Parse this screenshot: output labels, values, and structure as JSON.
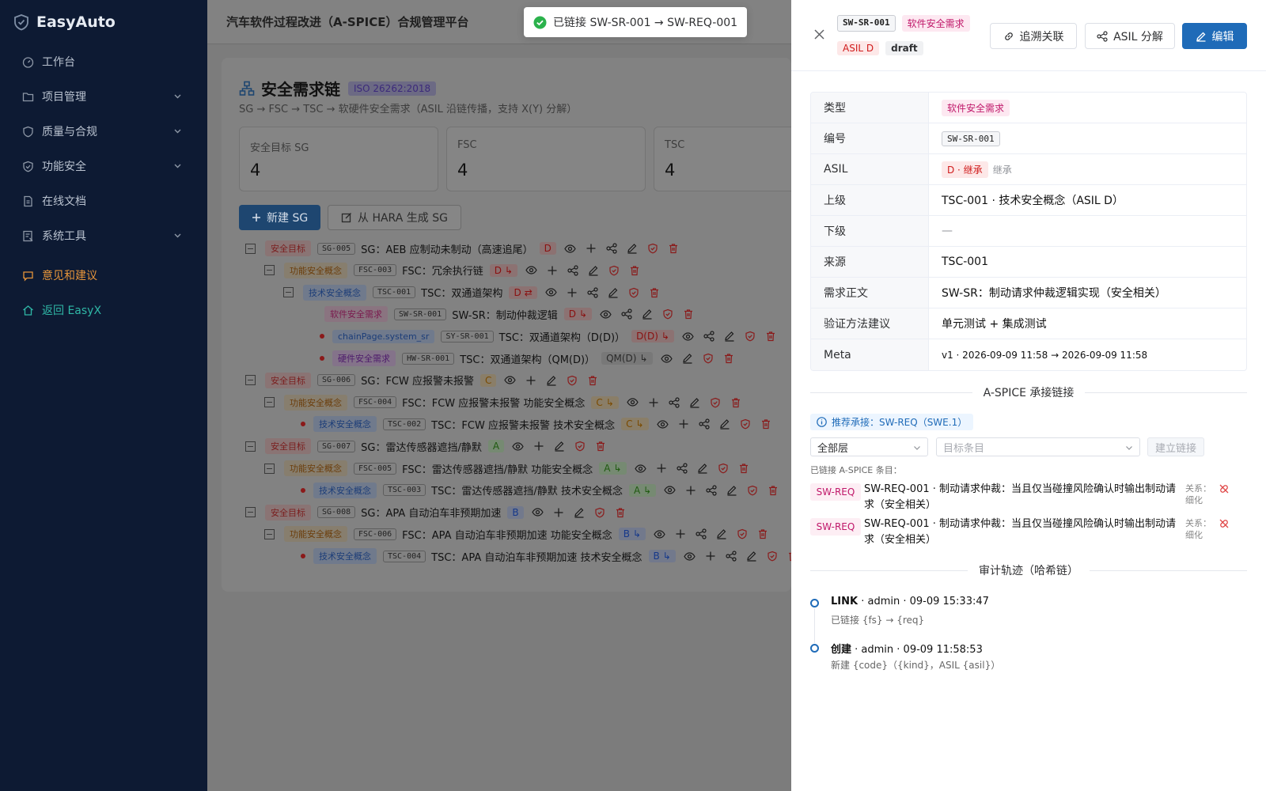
{
  "brand": "EasyAuto",
  "nav": [
    {
      "label": "工作台",
      "icon": "dashboard-icon",
      "chevron": false,
      "color": ""
    },
    {
      "label": "项目管理",
      "icon": "folder-icon",
      "chevron": true,
      "color": ""
    },
    {
      "label": "质量与合规",
      "icon": "shield-icon",
      "chevron": true,
      "color": ""
    },
    {
      "label": "功能安全",
      "icon": "shield-check-icon",
      "chevron": true,
      "color": ""
    },
    {
      "label": "在线文档",
      "icon": "document-icon",
      "chevron": false,
      "color": ""
    },
    {
      "label": "系统工具",
      "icon": "tool-icon",
      "chevron": true,
      "color": ""
    }
  ],
  "nav_extra": [
    {
      "label": "意见和建议",
      "icon": "chat-icon",
      "color": "orange"
    },
    {
      "label": "返回 EasyX",
      "icon": "home-icon",
      "color": "teal"
    }
  ],
  "page_title": "汽车软件过程改进（A-SPICE）合规管理平台",
  "chain": {
    "title": "安全需求链",
    "standard": "ISO 26262:2018",
    "subtitle": "SG → FSC → TSC → 软硬件安全需求（ASIL 沿链传播，支持 X(Y) 分解）",
    "stats": [
      {
        "label": "安全目标 SG",
        "value": "4"
      },
      {
        "label": "FSC",
        "value": "4"
      },
      {
        "label": "TSC",
        "value": "4"
      }
    ],
    "new_sg": "新建 SG",
    "from_hara": "从 HARA 生成 SG"
  },
  "tree": [
    {
      "level": 0,
      "node": "toggle",
      "kind": "安全目标",
      "kclass": "k-sg",
      "code": "SG-005",
      "title": "SG：AEB 应制动未制动（高速追尾）",
      "asil": "D",
      "aclass": "a-red",
      "asil_icon": "",
      "ops": [
        "eye",
        "plus",
        "share",
        "edit",
        "shield",
        "trash"
      ]
    },
    {
      "level": 1,
      "node": "toggle",
      "kind": "功能安全概念",
      "kclass": "k-fsc",
      "code": "FSC-003",
      "title": "FSC：冗余执行链",
      "asil": "D",
      "aclass": "a-red",
      "asil_icon": "inherit",
      "ops": [
        "eye",
        "plus",
        "share",
        "edit",
        "shield",
        "trash"
      ]
    },
    {
      "level": 2,
      "node": "toggle",
      "kind": "技术安全概念",
      "kclass": "k-tsc",
      "code": "TSC-001",
      "title": "TSC：双通道架构",
      "asil": "D",
      "aclass": "a-red",
      "asil_icon": "split",
      "ops": [
        "eye",
        "plus",
        "share",
        "edit",
        "shield",
        "trash"
      ]
    },
    {
      "level": 3,
      "node": "none",
      "kind": "软件安全需求",
      "kclass": "k-sw",
      "code": "SW-SR-001",
      "title": "SW-SR：制动仲裁逻辑",
      "asil": "D",
      "aclass": "a-red",
      "asil_icon": "inherit",
      "ops": [
        "eye",
        "share",
        "edit",
        "shield",
        "trash"
      ]
    },
    {
      "level": 3,
      "node": "dot",
      "kind": "chainPage.system_sr",
      "kclass": "k-sys",
      "code": "SY-SR-001",
      "title": "TSC：双通道架构（D(D)）",
      "asil": "D(D)",
      "aclass": "a-red",
      "asil_icon": "inherit",
      "ops": [
        "eye",
        "share",
        "edit",
        "shield",
        "trash"
      ]
    },
    {
      "level": 3,
      "node": "dot",
      "kind": "硬件安全需求",
      "kclass": "k-hw",
      "code": "HW-SR-001",
      "title": "TSC：双通道架构（QM(D)）",
      "asil": "QM(D)",
      "aclass": "a-gry",
      "asil_icon": "inherit",
      "ops": [
        "eye",
        "edit",
        "shield",
        "trash"
      ]
    },
    {
      "level": 0,
      "node": "toggle",
      "kind": "安全目标",
      "kclass": "k-sg",
      "code": "SG-006",
      "title": "SG：FCW 应报警未报警",
      "asil": "C",
      "aclass": "a-org",
      "asil_icon": "",
      "ops": [
        "eye",
        "plus",
        "edit",
        "shield",
        "trash"
      ]
    },
    {
      "level": 1,
      "node": "toggle",
      "kind": "功能安全概念",
      "kclass": "k-fsc",
      "code": "FSC-004",
      "title": "FSC：FCW 应报警未报警 功能安全概念",
      "asil": "C",
      "aclass": "a-org",
      "asil_icon": "inherit",
      "ops": [
        "eye",
        "plus",
        "share",
        "edit",
        "shield",
        "trash"
      ]
    },
    {
      "level": 2,
      "node": "dot",
      "kind": "技术安全概念",
      "kclass": "k-tsc",
      "code": "TSC-002",
      "title": "TSC：FCW 应报警未报警 技术安全概念",
      "asil": "C",
      "aclass": "a-org",
      "asil_icon": "inherit",
      "ops": [
        "eye",
        "plus",
        "share",
        "edit",
        "shield",
        "trash"
      ]
    },
    {
      "level": 0,
      "node": "toggle",
      "kind": "安全目标",
      "kclass": "k-sg",
      "code": "SG-007",
      "title": "SG：雷达传感器遮挡/静默",
      "asil": "A",
      "aclass": "a-grn",
      "asil_icon": "",
      "ops": [
        "eye",
        "plus",
        "edit",
        "shield",
        "trash"
      ]
    },
    {
      "level": 1,
      "node": "toggle",
      "kind": "功能安全概念",
      "kclass": "k-fsc",
      "code": "FSC-005",
      "title": "FSC：雷达传感器遮挡/静默 功能安全概念",
      "asil": "A",
      "aclass": "a-grn",
      "asil_icon": "inherit",
      "ops": [
        "eye",
        "plus",
        "share",
        "edit",
        "shield",
        "trash"
      ]
    },
    {
      "level": 2,
      "node": "dot",
      "kind": "技术安全概念",
      "kclass": "k-tsc",
      "code": "TSC-003",
      "title": "TSC：雷达传感器遮挡/静默 技术安全概念",
      "asil": "A",
      "aclass": "a-grn",
      "asil_icon": "inherit",
      "ops": [
        "eye",
        "plus",
        "share",
        "edit",
        "shield",
        "trash"
      ]
    },
    {
      "level": 0,
      "node": "toggle",
      "kind": "安全目标",
      "kclass": "k-sg",
      "code": "SG-008",
      "title": "SG：APA 自动泊车非预期加速",
      "asil": "B",
      "aclass": "a-blu",
      "asil_icon": "",
      "ops": [
        "eye",
        "plus",
        "edit",
        "shield",
        "trash"
      ]
    },
    {
      "level": 1,
      "node": "toggle",
      "kind": "功能安全概念",
      "kclass": "k-fsc",
      "code": "FSC-006",
      "title": "FSC：APA 自动泊车非预期加速 功能安全概念",
      "asil": "B",
      "aclass": "a-blu",
      "asil_icon": "inherit",
      "ops": [
        "eye",
        "plus",
        "share",
        "edit",
        "shield",
        "trash"
      ]
    },
    {
      "level": 2,
      "node": "dot",
      "kind": "技术安全概念",
      "kclass": "k-tsc",
      "code": "TSC-004",
      "title": "TSC：APA 自动泊车非预期加速 技术安全概念",
      "asil": "B",
      "aclass": "a-blu",
      "asil_icon": "inherit",
      "ops": [
        "eye",
        "plus",
        "share",
        "edit",
        "shield",
        "trash"
      ]
    }
  ],
  "toast": "已链接 SW-SR-001 → SW-REQ-001",
  "drawer": {
    "code": "SW-SR-001",
    "kind": "软件安全需求",
    "asil": "ASIL D",
    "status": "draft",
    "trace_btn": "追溯关联",
    "asil_btn": "ASIL 分解",
    "edit_btn": "编辑",
    "fields": {
      "type_k": "类型",
      "type_v": "软件安全需求",
      "code_k": "编号",
      "code_v": "SW-SR-001",
      "asil_k": "ASIL",
      "asil_v": "D · 继承",
      "asil_note": "继承",
      "parent_k": "上级",
      "parent_v": "TSC-001 · 技术安全概念（ASIL D）",
      "child_k": "下级",
      "child_v": "—",
      "source_k": "来源",
      "source_v": "TSC-001",
      "body_k": "需求正文",
      "body_v": "SW-SR：制动请求仲裁逻辑实现（安全相关）",
      "verify_k": "验证方法建议",
      "verify_v": "单元测试 + 集成测试",
      "meta_k": "Meta",
      "meta_v": "v1 · 2026-09-09 11:58 → 2026-09-09 11:58"
    },
    "aspice_title": "A-SPICE 承接链接",
    "recommend": "推荐承接：SW-REQ（SWE.1）",
    "layer_value": "全部层",
    "target_placeholder": "目标条目",
    "link_btn": "建立链接",
    "linked_label": "已链接 A-SPICE 条目：",
    "links": [
      {
        "tag": "SW-REQ",
        "text": "SW-REQ-001 · 制动请求仲裁：当且仅当碰撞风险确认时输出制动请求（安全相关）",
        "rel": "关系：细化"
      },
      {
        "tag": "SW-REQ",
        "text": "SW-REQ-001 · 制动请求仲裁：当且仅当碰撞风险确认时输出制动请求（安全相关）",
        "rel": "关系：细化"
      }
    ],
    "audit_title": "审计轨迹（哈希链）",
    "audit": [
      {
        "action": "LINK",
        "meta": " · admin · 09-09 15:33:47",
        "detail": "已链接 {fs} → {req}"
      },
      {
        "action": "创建",
        "meta": " · admin · 09-09 11:58:53",
        "detail": "新建 {code}（{kind}，ASIL {asil}）"
      }
    ]
  }
}
